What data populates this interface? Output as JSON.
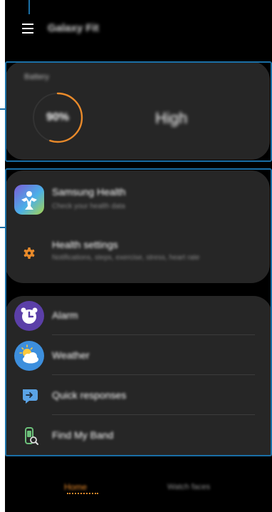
{
  "header": {
    "title": "Galaxy Fit",
    "menu_icon": "hamburger-menu-icon"
  },
  "battery": {
    "label": "Battery",
    "percent": "90%",
    "level_text": "High",
    "ring_fill": 0.55,
    "ring_color": "#e98a2a"
  },
  "list1": {
    "items": [
      {
        "title": "Samsung Health",
        "subtitle": "Check your health data",
        "icon": "samsung-health-icon"
      },
      {
        "title": "Health settings",
        "subtitle": "Notifications, steps, exercise, stress, heart rate",
        "icon": "gear-icon"
      }
    ]
  },
  "list2": {
    "items": [
      {
        "title": "Alarm",
        "icon": "alarm-clock-icon"
      },
      {
        "title": "Weather",
        "icon": "weather-icon"
      },
      {
        "title": "Quick responses",
        "icon": "quick-response-icon"
      },
      {
        "title": "Find My Band",
        "icon": "find-band-icon"
      }
    ]
  },
  "bottom_nav": {
    "home": "Home",
    "watch_faces": "Watch faces",
    "accent": "#e98a2a"
  },
  "colors": {
    "annotation": "#1a6fa6",
    "card": "#262626"
  }
}
